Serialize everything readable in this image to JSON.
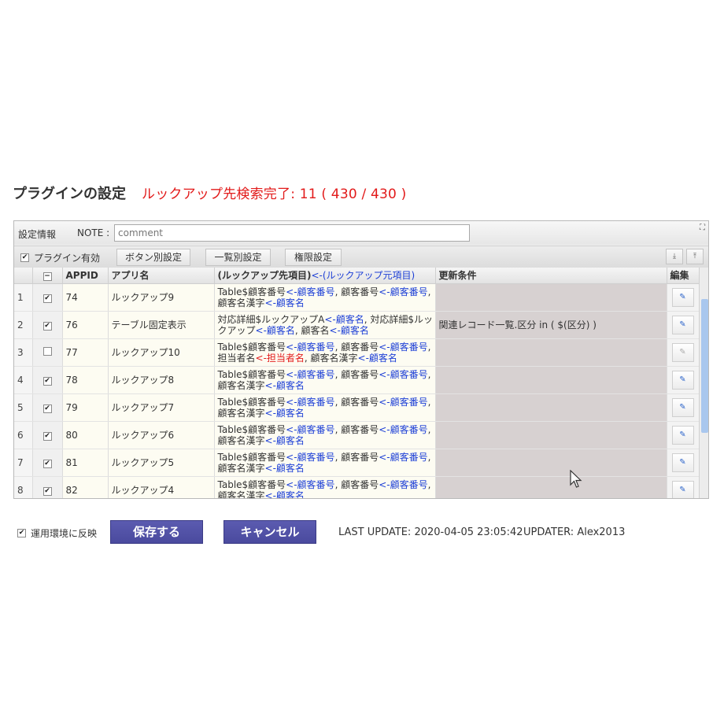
{
  "header": {
    "title": "プラグインの設定",
    "status": "ルックアップ先検索完了: 11 ( 430 / 430 )"
  },
  "panel": {
    "settings_label": "設定情報",
    "note_label": "NOTE :",
    "note_value": "comment",
    "plugin_enabled_label": "プラグイン有効",
    "buttons": {
      "button_settings": "ボタン別設定",
      "list_settings": "一覧別設定",
      "permission_settings": "権限設定"
    }
  },
  "table": {
    "columns": {
      "appid": "APPID",
      "app_name": "アプリ名",
      "lookup": "(ルックアップ先項目)",
      "lookup_src": "<-(ルックアップ元項目)",
      "condition": "更新条件",
      "edit": "編集"
    },
    "rows": [
      {
        "no": "1",
        "checked": true,
        "appid": "74",
        "name": "ルックアップ9",
        "lookup": [
          [
            "Table$顧客番号",
            "<-顧客番号",
            ", 顧客番号",
            "<-顧客番号",
            ","
          ],
          [
            "顧客名漢字",
            "<-顧客名"
          ]
        ],
        "cond": ""
      },
      {
        "no": "2",
        "checked": true,
        "appid": "76",
        "name": "テーブル固定表示",
        "lookup": [
          [
            "対応詳細$ルックアップA",
            "<-顧客名",
            ", 対応詳細$ルッ"
          ],
          [
            "クアップ",
            "<-顧客名",
            ", 顧客名",
            "<-顧客名"
          ]
        ],
        "cond": "関連レコード一覧.区分 in ( $(区分) )"
      },
      {
        "no": "3",
        "checked": false,
        "appid": "77",
        "name": "ルックアップ10",
        "lookup": [
          [
            "Table$顧客番号",
            "<-顧客番号",
            ", 顧客番号",
            "<-顧客番号",
            ","
          ],
          [
            "担当者名",
            "<-担当者名",
            ", 顧客名漢字",
            "<-顧客名"
          ]
        ],
        "cond": "",
        "red": "<-担当者名"
      },
      {
        "no": "4",
        "checked": true,
        "appid": "78",
        "name": "ルックアップ8",
        "lookup": [
          [
            "Table$顧客番号",
            "<-顧客番号",
            ", 顧客番号",
            "<-顧客番号",
            ","
          ],
          [
            "顧客名漢字",
            "<-顧客名"
          ]
        ],
        "cond": ""
      },
      {
        "no": "5",
        "checked": true,
        "appid": "79",
        "name": "ルックアップ7",
        "lookup": [
          [
            "Table$顧客番号",
            "<-顧客番号",
            ", 顧客番号",
            "<-顧客番号",
            ","
          ],
          [
            "顧客名漢字",
            "<-顧客名"
          ]
        ],
        "cond": ""
      },
      {
        "no": "6",
        "checked": true,
        "appid": "80",
        "name": "ルックアップ6",
        "lookup": [
          [
            "Table$顧客番号",
            "<-顧客番号",
            ", 顧客番号",
            "<-顧客番号",
            ","
          ],
          [
            "顧客名漢字",
            "<-顧客名"
          ]
        ],
        "cond": ""
      },
      {
        "no": "7",
        "checked": true,
        "appid": "81",
        "name": "ルックアップ5",
        "lookup": [
          [
            "Table$顧客番号",
            "<-顧客番号",
            ", 顧客番号",
            "<-顧客番号",
            ","
          ],
          [
            "顧客名漢字",
            "<-顧客名"
          ]
        ],
        "cond": ""
      },
      {
        "no": "8",
        "checked": true,
        "appid": "82",
        "name": "ルックアップ4",
        "lookup": [
          [
            "Table$顧客番号",
            "<-顧客番号",
            ", 顧客番号",
            "<-顧客番号",
            ","
          ],
          [
            "顧客名漢字",
            "<-顧客名"
          ]
        ],
        "cond": ""
      }
    ]
  },
  "footer": {
    "reflect_label": "運用環境に反映",
    "save": "保存する",
    "cancel": "キャンセル",
    "last_update": "LAST UPDATE: 2020-04-05 23:05:42",
    "updater": "UPDATER: Alex2013"
  },
  "colors": {
    "status_red": "#e21a1a",
    "arrow_blue": "#1d3fd6",
    "primary_button": "#4f4fa3"
  }
}
